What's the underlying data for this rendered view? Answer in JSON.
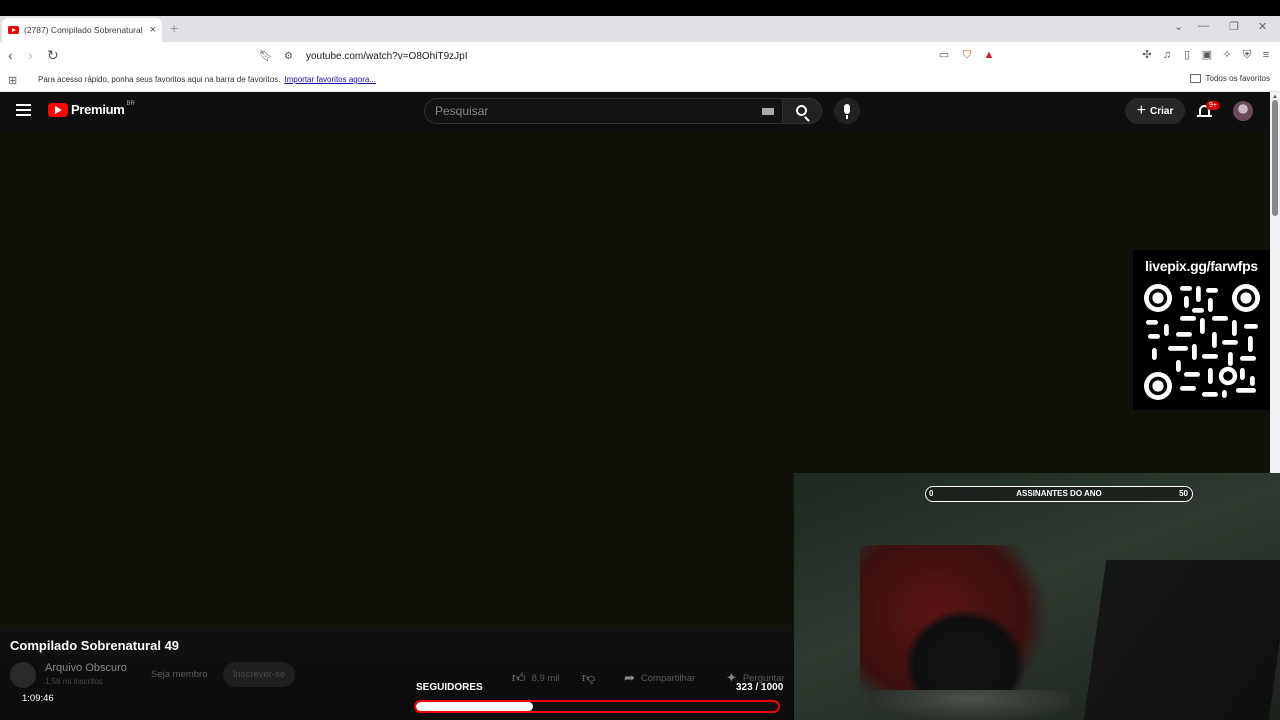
{
  "browser": {
    "tab_title": "(2787) Compilado Sobrenatural",
    "tab_close": "×",
    "new_tab": "+",
    "url": "youtube.com/watch?v=O8OhiT9zJpI",
    "bookmarks_message": "Para acesso rápido, ponha seus favoritos aqui na barra de favoritos.",
    "bookmarks_import_link": "Importar favoritos agora...",
    "all_favorites": "Todos os favoritos"
  },
  "youtube": {
    "logo_text": "Premium",
    "logo_region": "BR",
    "search_placeholder": "Pesquisar",
    "create_label": "Criar",
    "notifications_badge": "9+"
  },
  "video": {
    "title": "Compilado Sobrenatural 49",
    "channel_name": "Arquivo Obscuro",
    "channel_subs": "1,58 mi inscritos",
    "member_label": "Seja membro",
    "subscribe_label": "Inscrever-se",
    "likes": "8,9 mil",
    "share_label": "Compartilhar",
    "ask_label": "Perguntar",
    "timestamp": "1:09:46"
  },
  "overlay": {
    "qr_label": "livepix.gg/farwfps",
    "followers_label": "SEGUIDORES",
    "followers_count": "323 / 1000",
    "followers_progress": 0.323,
    "year_subs_label": "ASSINANTES DO ANO",
    "year_subs_min": "0",
    "year_subs_max": "50"
  },
  "colors": {
    "yt_red": "#ff0000",
    "bar_border": "#ee0000"
  }
}
